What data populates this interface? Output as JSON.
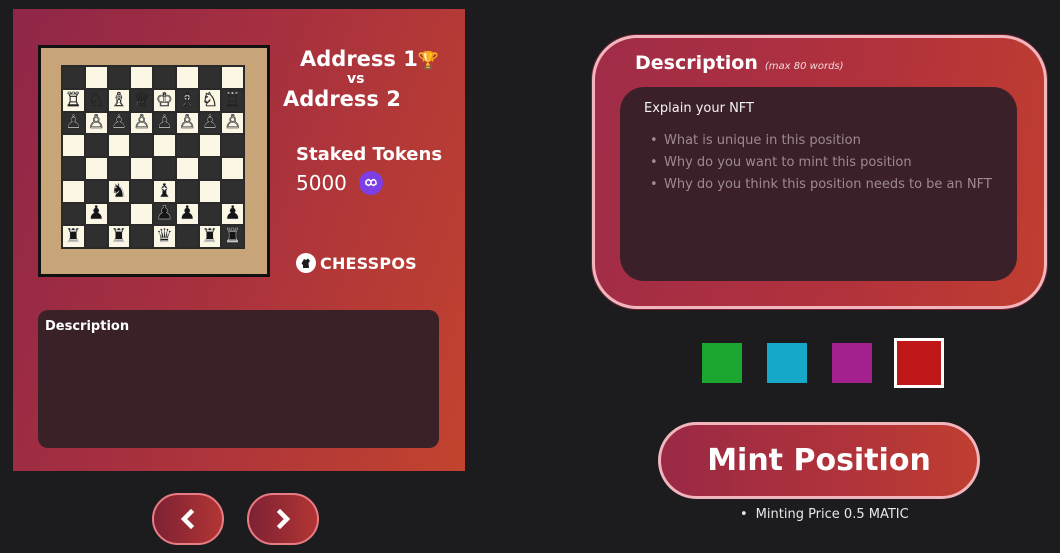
{
  "card": {
    "player1": "Address 1",
    "vs": "vs",
    "player2": "Address 2",
    "staked_title": "Staked Tokens",
    "staked_value": "5000",
    "brand_name": "CHESSPOS",
    "description_label": "Description",
    "board": [
      [
        "",
        "",
        "",
        "",
        "",
        "",
        "",
        ""
      ],
      [
        "wR",
        "wN",
        "wB",
        "wQ",
        "wK",
        "wB",
        "wN",
        "wR"
      ],
      [
        "wP",
        "wP",
        "wP",
        "wP",
        "wP",
        "wP",
        "wP",
        "wP"
      ],
      [
        "",
        "",
        "",
        "",
        "",
        "",
        "",
        ""
      ],
      [
        "",
        "",
        "",
        "",
        "",
        "",
        "",
        ""
      ],
      [
        "",
        "",
        "bN",
        "",
        "bB",
        "",
        "",
        ""
      ],
      [
        "",
        "bP",
        "",
        "",
        "bP",
        "bP",
        "",
        "bP"
      ],
      [
        "bR",
        "",
        "bR",
        "",
        "bQ",
        "",
        "bR",
        "bR"
      ]
    ]
  },
  "nav": {
    "prev_icon": "chevron-left-icon",
    "next_icon": "chevron-right-icon"
  },
  "editor": {
    "title": "Description",
    "hint": "(max 80 words)",
    "placeholder_heading": "Explain your NFT",
    "bullets": [
      "What is unique in this position",
      "Why do you want to mint this position",
      "Why do you think this position needs to be an NFT"
    ]
  },
  "swatches": [
    {
      "name": "green",
      "color": "#1aa62f"
    },
    {
      "name": "cyan",
      "color": "#16a7c9"
    },
    {
      "name": "purple",
      "color": "#a3208e"
    },
    {
      "name": "red",
      "color": "#c01818",
      "selected": true
    }
  ],
  "mint": {
    "label": "Mint Position",
    "price_text": "Minting Price 0.5 MATIC"
  }
}
